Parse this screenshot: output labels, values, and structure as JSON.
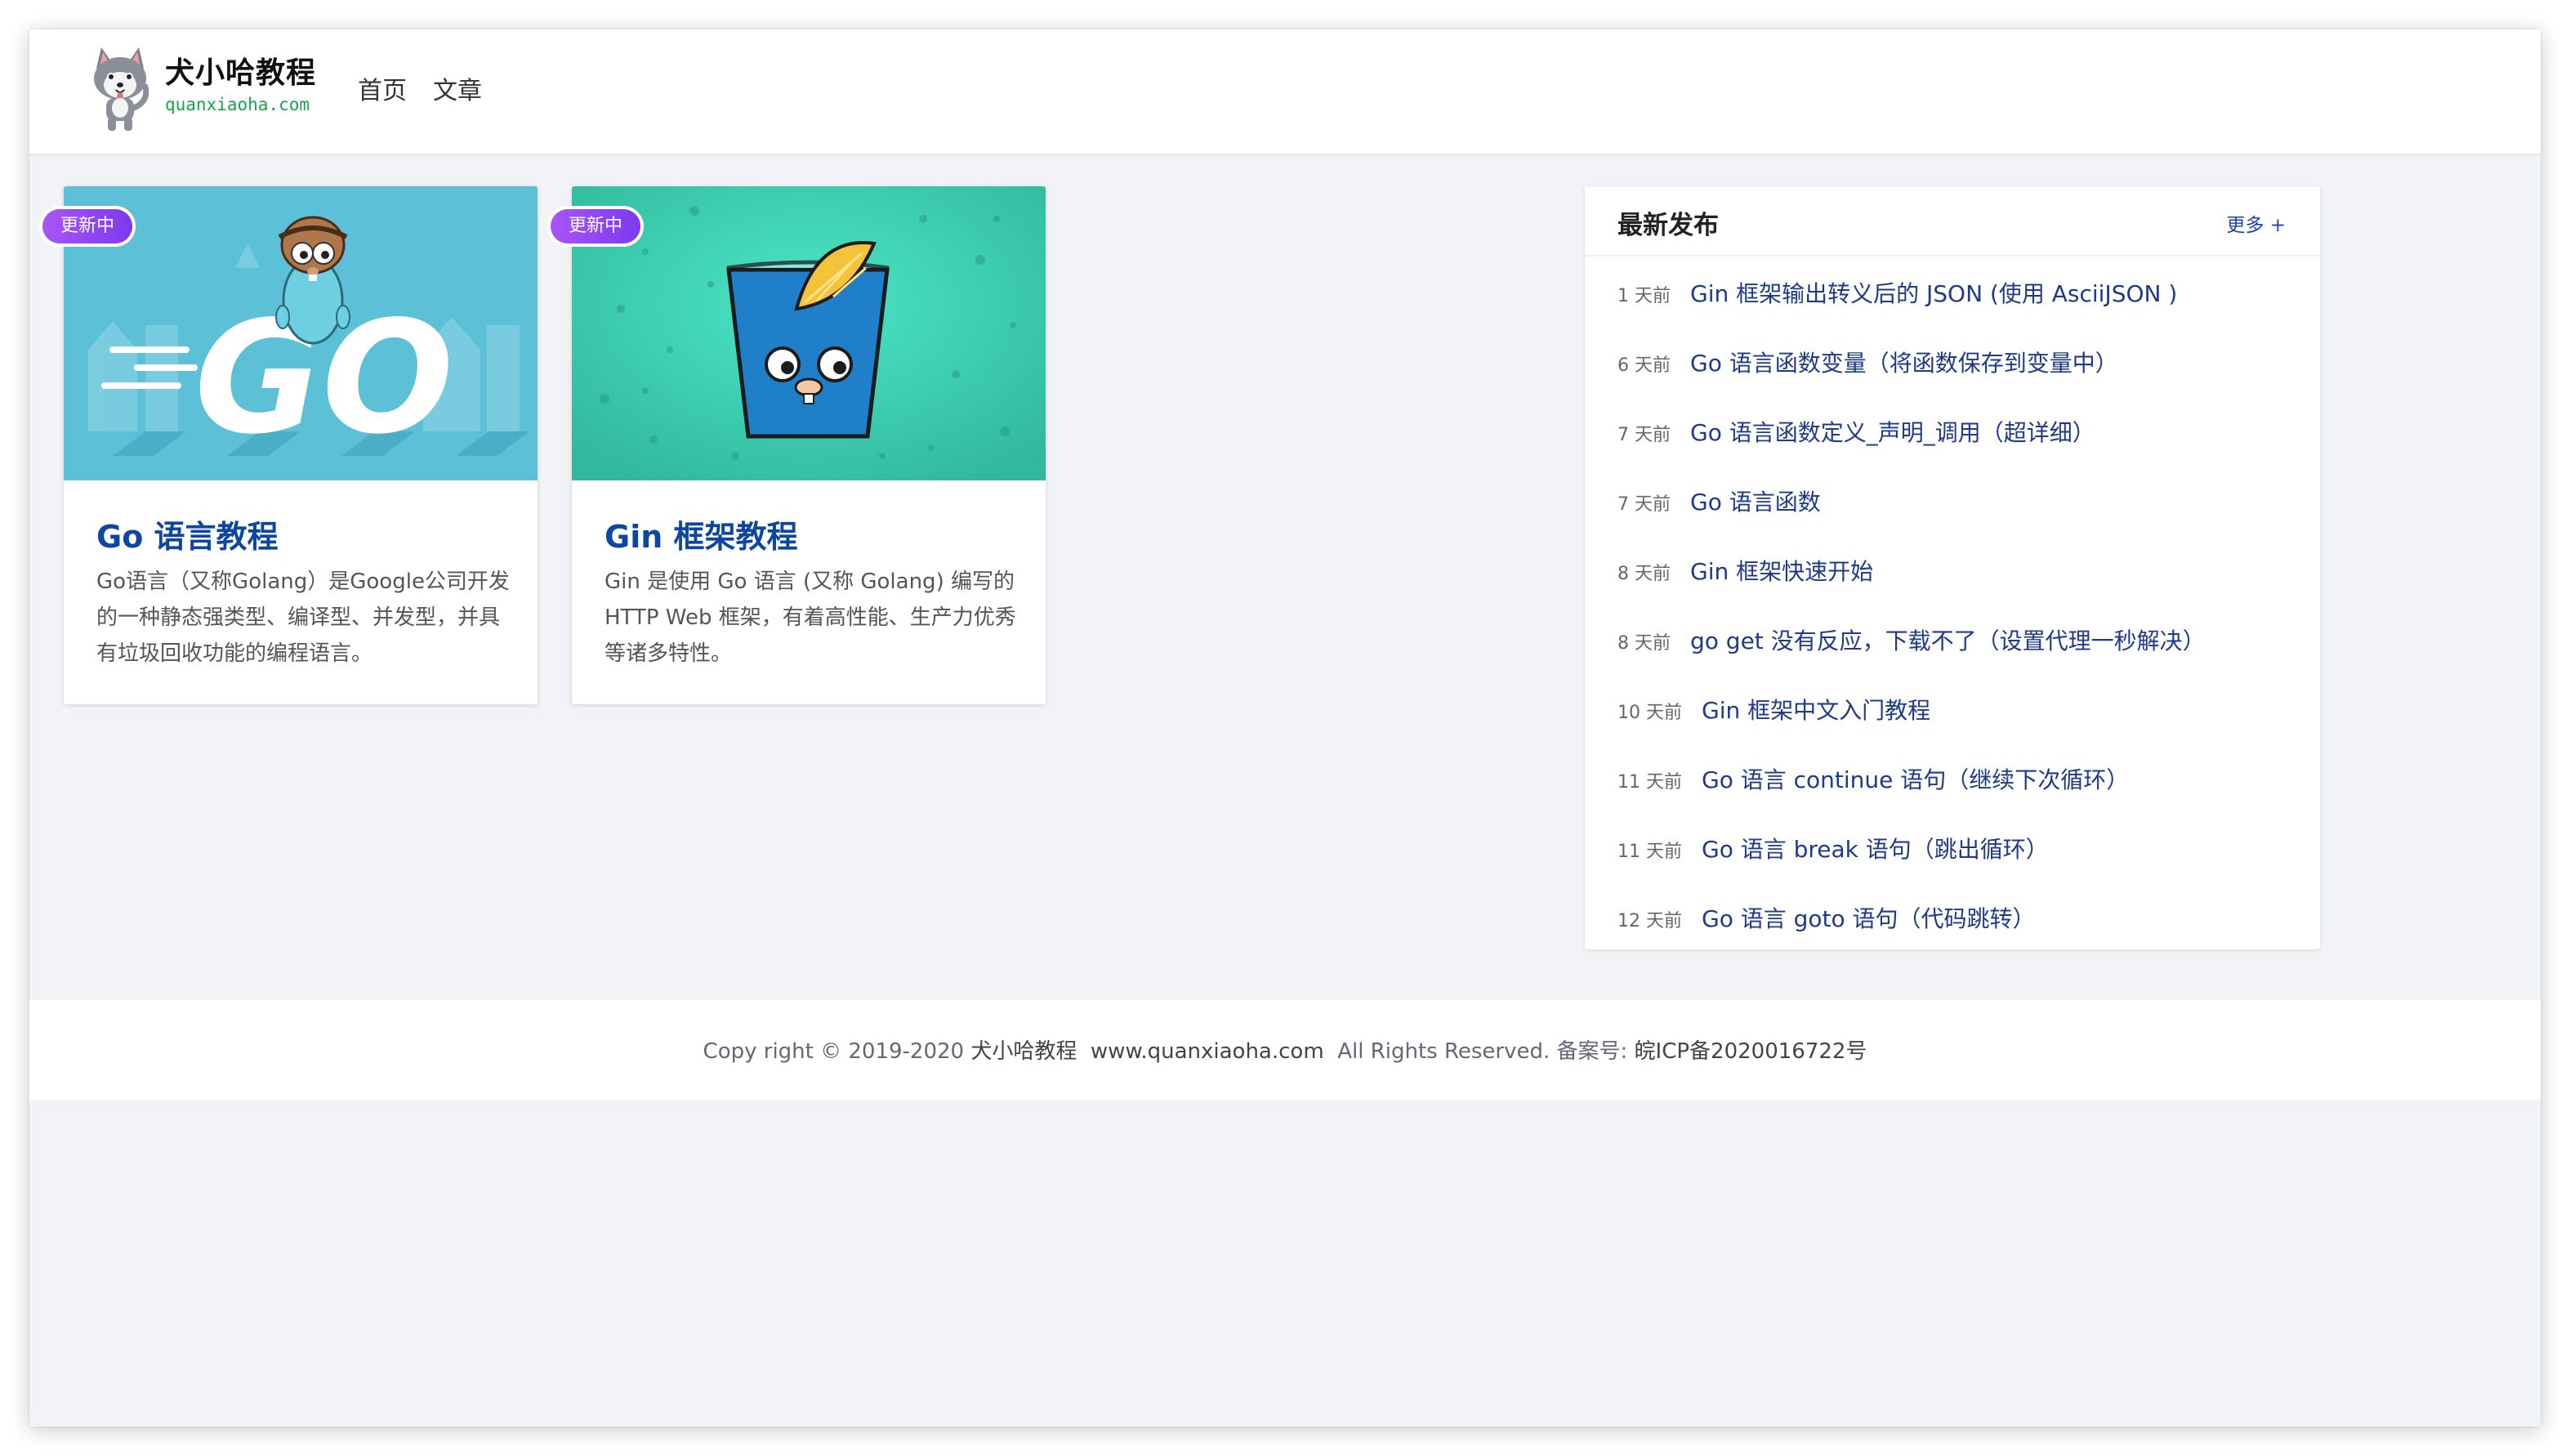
{
  "site": {
    "logo_title": "犬小哈教程",
    "logo_sub": "quanxiaoha.com",
    "nav": [
      "首页",
      "文章"
    ]
  },
  "cards": [
    {
      "badge": "更新中",
      "title": "Go 语言教程",
      "description": "Go语言（又称Golang）是Google公司开发的一种静态强类型、编译型、并发型，并具有垃圾回收功能的编程语言。"
    },
    {
      "badge": "更新中",
      "title": "Gin 框架教程",
      "description": "Gin 是使用 Go 语言 (又称 Golang) 编写的 HTTP Web 框架，有着高性能、生产力优秀等诸多特性。"
    }
  ],
  "latest": {
    "title": "最新发布",
    "more": "更多 +",
    "items": [
      {
        "time": "1 天前",
        "title": "Gin 框架输出转义后的 JSON (使用 AsciiJSON )"
      },
      {
        "time": "6 天前",
        "title": "Go 语言函数变量（将函数保存到变量中）"
      },
      {
        "time": "7 天前",
        "title": "Go 语言函数定义_声明_调用（超详细）"
      },
      {
        "time": "7 天前",
        "title": "Go 语言函数"
      },
      {
        "time": "8 天前",
        "title": "Gin 框架快速开始"
      },
      {
        "time": "8 天前",
        "title": "go get 没有反应，下载不了（设置代理一秒解决）"
      },
      {
        "time": "10 天前",
        "title": "Gin 框架中文入门教程"
      },
      {
        "time": "11 天前",
        "title": "Go 语言 continue 语句（继续下次循环）"
      },
      {
        "time": "11 天前",
        "title": "Go 语言 break 语句（跳出循环）"
      },
      {
        "time": "12 天前",
        "title": "Go 语言 goto 语句（代码跳转）"
      }
    ]
  },
  "footer": {
    "copyright": "Copy right © 2019-2020",
    "site_name": "犬小哈教程",
    "domain": "www.quanxiaoha.com",
    "rights": "All Rights Reserved. 备案号:",
    "icp": "皖ICP备2020016722号"
  },
  "colors": {
    "accent": "#1e3a8a",
    "badge": "#8b5cf6",
    "logo_sub": "#17a34a"
  }
}
